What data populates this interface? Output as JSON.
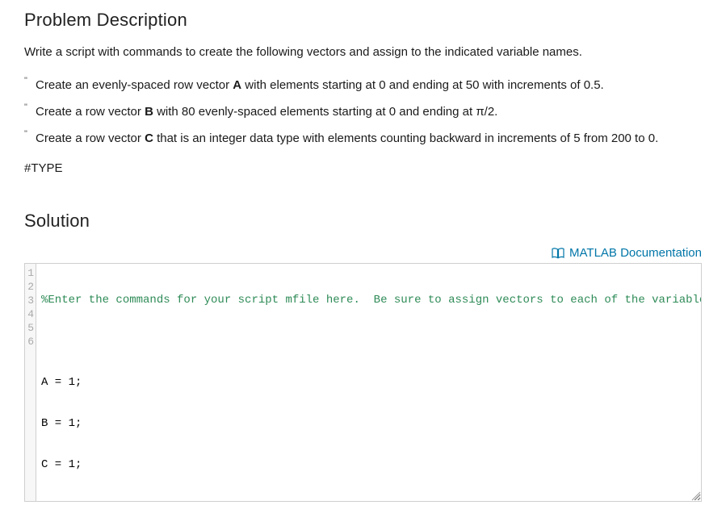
{
  "headings": {
    "problem": "Problem Description",
    "solution": "Solution"
  },
  "description": "Write a script with commands to create the following vectors and assign to the indicated variable names.",
  "bullets": [
    {
      "pre": "Create an evenly-spaced row vector ",
      "bold": "A",
      "post": " with elements starting at 0 and ending at 50 with increments of 0.5."
    },
    {
      "pre": "Create a row vector ",
      "bold": "B",
      "post": " with 80 evenly-spaced elements starting at 0 and ending at π/2."
    },
    {
      "pre": "Create a row vector ",
      "bold": "C",
      "post": " that is an integer data type with elements counting backward in increments of 5 from 200 to 0."
    }
  ],
  "tag": "#TYPE",
  "doc_link": "MATLAB Documentation",
  "editor": {
    "gutter": [
      "1",
      "2",
      "3",
      "4",
      "5",
      "6"
    ],
    "lines": [
      {
        "type": "comment",
        "text": "%Enter the commands for your script mfile here.  Be sure to assign vectors to each of the variables"
      },
      {
        "type": "blank",
        "text": ""
      },
      {
        "type": "code",
        "text": "A = 1;"
      },
      {
        "type": "code",
        "text": "B = 1;"
      },
      {
        "type": "code",
        "text": "C = 1;"
      },
      {
        "type": "blank",
        "text": ""
      }
    ]
  }
}
